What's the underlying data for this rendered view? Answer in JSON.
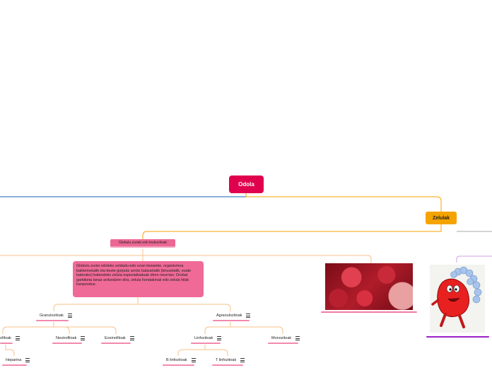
{
  "colors": {
    "root": "#e0004d",
    "zelulak": "#f5a300",
    "pink": "#ec6794",
    "blue_line": "#1a5fb4",
    "orange_line": "#f5a300",
    "purple": "#9a20c8"
  },
  "root": {
    "label": "Odola"
  },
  "zelulak": {
    "label": "Zelulak"
  },
  "globulu_zuriak": {
    "label": "Globulu zuriak edo leukozitoak"
  },
  "description": "Globulu zuriei odoleko soldadu-edo ezan liezaieke, organismoa bakterioetatik eta beste gorputz arrotz batzuetatik (birusetatik, esate baterako) babesteko zelula espezializatuak diren neurrian. Orobat garbiketa lanaz arduratzen dira, zelula hondakinak edo zelula hilak kanporatuz.",
  "nodes": {
    "granulozitoak": "Granulozitoak",
    "agranulozitoak": "Agranulozitoak",
    "basofiloak": "ofiloak",
    "neutrofiloak": "Neutrofiloak",
    "eosinofiloak": "Eosinofiloak",
    "linfozitoak": "Linfozitoak",
    "monozitoak": "Monozitoak",
    "heparina": "Heparina",
    "b_linfozitoak": "B linfozitoak",
    "t_linfozitoak": "T linfozitoak"
  },
  "icons": [
    "menu-icon"
  ]
}
